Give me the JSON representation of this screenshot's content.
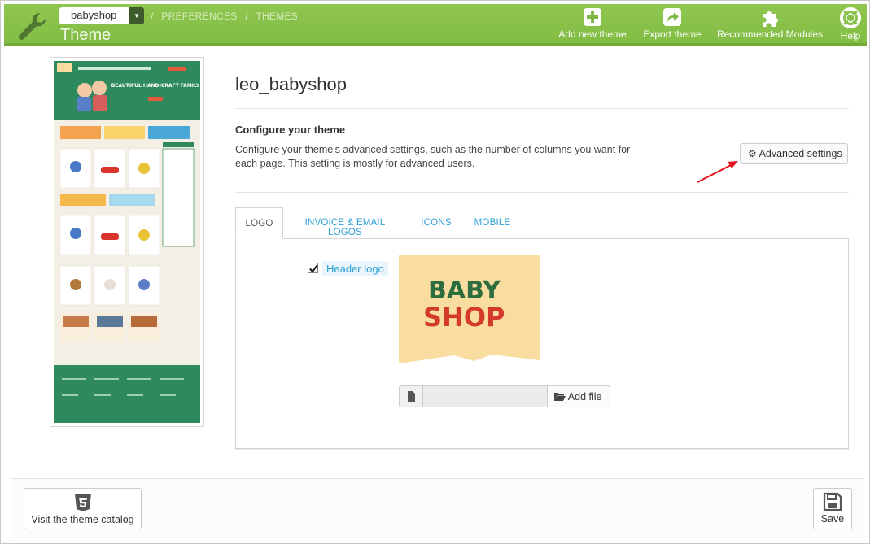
{
  "header": {
    "shop_selector": "babyshop",
    "breadcrumb": [
      "PREFERENCES",
      "THEMES"
    ],
    "breadcrumb_sep": "/",
    "title": "Theme",
    "toolbar": {
      "add_theme": "Add new theme",
      "export_theme": "Export theme",
      "recommended": "Recommended Modules",
      "help": "Help"
    }
  },
  "theme": {
    "name": "leo_babyshop",
    "configure_title": "Configure your theme",
    "configure_desc": "Configure your theme's advanced settings, such as the number of columns you want for each page. This setting is mostly for advanced users.",
    "advanced_button": "Advanced settings",
    "preview_logo_text": "BABY SHOP",
    "preview_banner": "BEAUTIFUL HANDICRAFT FAMILY"
  },
  "tabs": [
    "LOGO",
    "INVOICE & EMAIL LOGOS",
    "ICONS",
    "MOBILE"
  ],
  "logo_tab": {
    "checkbox_label": "Header logo",
    "checked": true,
    "logo_line1": "BABY",
    "logo_line2": "SHOP",
    "add_file_label": "Add file"
  },
  "footer": {
    "catalog_button": "Visit the theme catalog",
    "save_button": "Save"
  },
  "colors": {
    "header_green": "#8bc34a",
    "link_blue": "#2ea1d6",
    "logo_green": "#2e6e3e",
    "logo_red": "#d33a2c",
    "logo_bg": "#f8dca0",
    "arrow_red": "#e0121a"
  },
  "icons": {
    "brand": "wrench-icon",
    "add_theme": "plus-square-icon",
    "export_theme": "share-icon",
    "recommended": "puzzle-icon",
    "help": "lifebuoy-icon",
    "advanced": "gear-icon",
    "file": "file-icon",
    "add_file": "folder-open-icon",
    "catalog": "html5-icon",
    "save": "floppy-disk-icon"
  }
}
